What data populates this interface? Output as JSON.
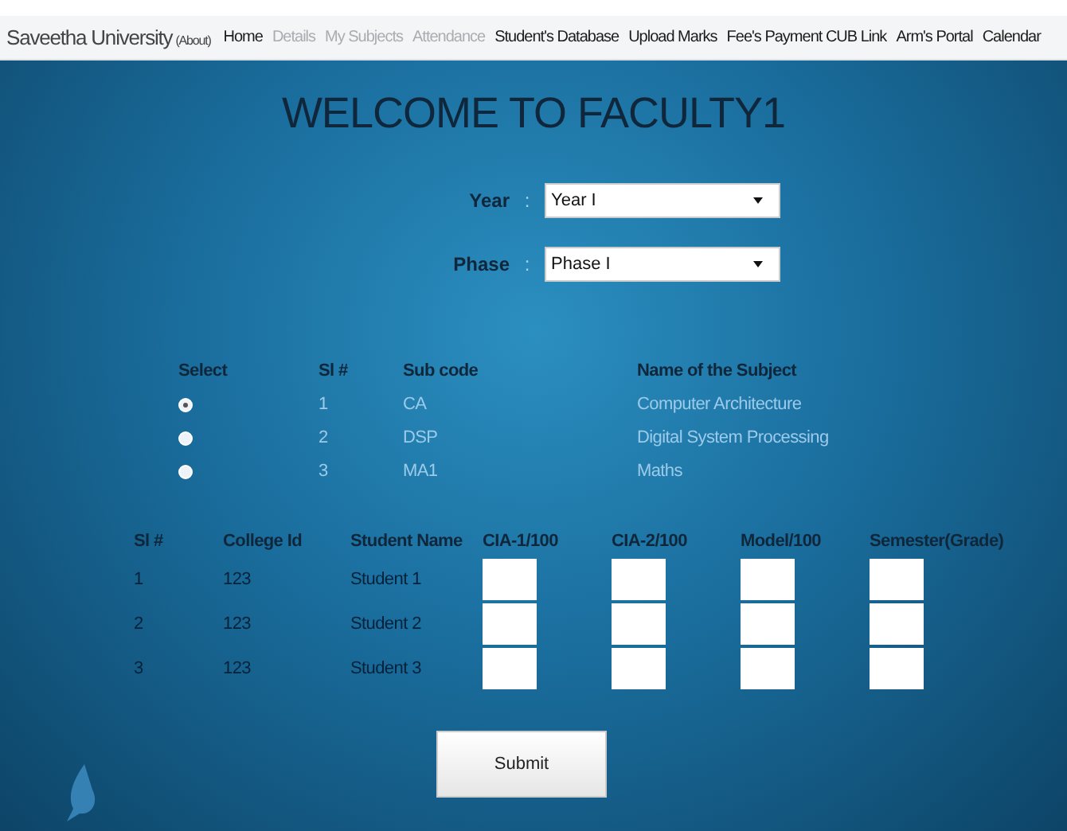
{
  "navbar": {
    "brand": "Saveetha University",
    "brand_note": "(About)",
    "items": [
      {
        "label": "Home",
        "disabled": false
      },
      {
        "label": "Details",
        "disabled": true
      },
      {
        "label": "My Subjects",
        "disabled": true
      },
      {
        "label": "Attendance",
        "disabled": true
      },
      {
        "label": "Student's Database",
        "disabled": false
      },
      {
        "label": "Upload Marks",
        "disabled": false
      },
      {
        "label": "Fee's Payment CUB Link",
        "disabled": false
      },
      {
        "label": "Arm's Portal",
        "disabled": false
      },
      {
        "label": "Calendar",
        "disabled": false
      }
    ]
  },
  "title": "WELCOME TO FACULTY1",
  "filters": [
    {
      "label": "Year",
      "separator": ":",
      "value": "Year I"
    },
    {
      "label": "Phase",
      "separator": ":",
      "value": "Phase I"
    }
  ],
  "subjects": {
    "columns": [
      "Select",
      "Sl #",
      "Sub code",
      "Name of the Subject"
    ],
    "rows": [
      {
        "selected": true,
        "sl": "1",
        "code": "CA",
        "name": "Computer Architecture"
      },
      {
        "selected": false,
        "sl": "2",
        "code": "DSP",
        "name": "Digital System Processing"
      },
      {
        "selected": false,
        "sl": "3",
        "code": "MA1",
        "name": "Maths"
      }
    ]
  },
  "students": {
    "columns": [
      "Sl #",
      "College Id",
      "Student Name",
      "CIA-1/100",
      "CIA-2/100",
      "Model/100",
      "Semester(Grade)"
    ],
    "rows": [
      {
        "sl": "1",
        "college_id": "123",
        "name": "Student 1"
      },
      {
        "sl": "2",
        "college_id": "123",
        "name": "Student 2"
      },
      {
        "sl": "3",
        "college_id": "123",
        "name": "Student 3"
      }
    ]
  },
  "submit": "Submit"
}
